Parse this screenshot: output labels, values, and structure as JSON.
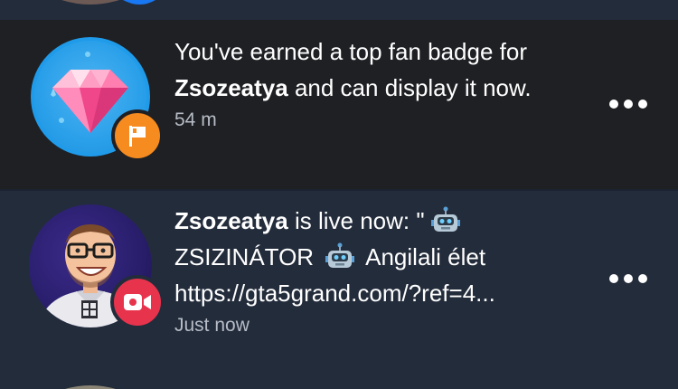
{
  "notifications": [
    {
      "message_prefix": "You've earned a top fan badge for ",
      "name": "Zsozeatya",
      "message_suffix": " and can display it now.",
      "time": "54 m",
      "type_icon": "flag-icon",
      "avatar_icon": "diamond-icon"
    },
    {
      "name": "Zsozeatya",
      "line1_suffix": " is live now: \"",
      "line2_text": "ZSIZINÁTOR",
      "line2_suffix": "Angilali élet",
      "line3": "https://gta5grand.com/?ref=4...",
      "time": "Just now",
      "type_icon": "video-camera-icon",
      "emoji_icon": "robot-emoji"
    }
  ],
  "colors": {
    "background": "#222b3a",
    "highlight_row": "#1f2024",
    "flag_badge": "#f68b1f",
    "video_badge": "#e8334d",
    "diamond_circle": "#1f9bea"
  }
}
